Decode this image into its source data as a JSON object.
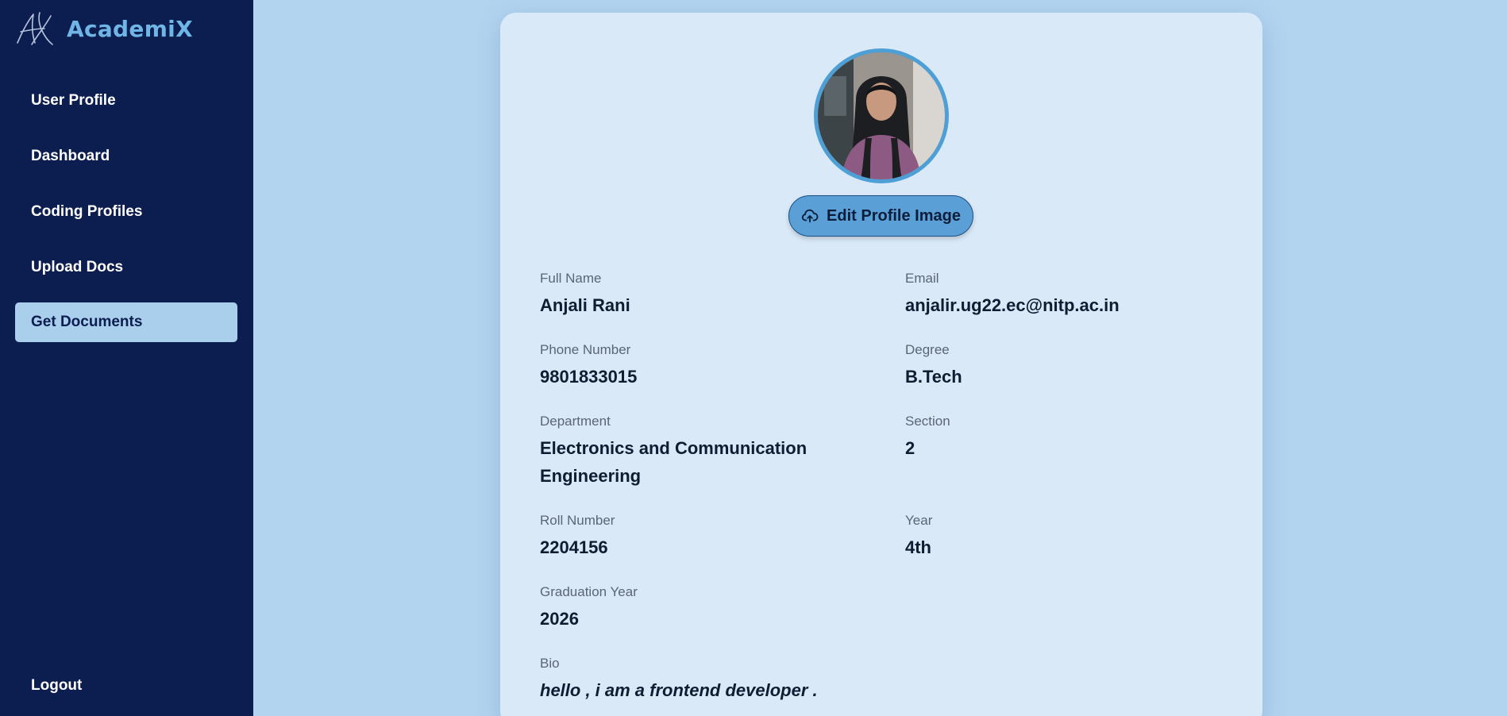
{
  "brand": {
    "name": "AcademiX",
    "logo_icon": "script-ax-logo-icon"
  },
  "sidebar": {
    "items": [
      {
        "label": "User Profile"
      },
      {
        "label": "Dashboard"
      },
      {
        "label": "Coding Profiles"
      },
      {
        "label": "Upload Docs"
      },
      {
        "label": "Get Documents",
        "active": true
      }
    ],
    "logout_label": "Logout"
  },
  "profile": {
    "edit_image_label": "Edit Profile Image",
    "edit_image_icon": "cloud-upload-icon",
    "fields": {
      "full_name": {
        "label": "Full Name",
        "value": "Anjali Rani"
      },
      "email": {
        "label": "Email",
        "value": "anjalir.ug22.ec@nitp.ac.in"
      },
      "phone": {
        "label": "Phone Number",
        "value": "9801833015"
      },
      "degree": {
        "label": "Degree",
        "value": "B.Tech"
      },
      "department": {
        "label": "Department",
        "value": "Electronics and Communication Engineering"
      },
      "section": {
        "label": "Section",
        "value": "2"
      },
      "roll": {
        "label": "Roll Number",
        "value": "2204156"
      },
      "year": {
        "label": "Year",
        "value": "4th"
      },
      "graduation": {
        "label": "Graduation Year",
        "value": "2026"
      },
      "bio": {
        "label": "Bio",
        "value": "hello , i am a frontend developer ."
      }
    }
  },
  "colors": {
    "sidebar_bg": "#0c1d4f",
    "page_bg": "#b3d4ef",
    "card_bg": "#d9e9f8",
    "accent": "#5aa0d6",
    "active_nav_bg": "#a9cfec",
    "brand_text": "#6fb5e6"
  }
}
